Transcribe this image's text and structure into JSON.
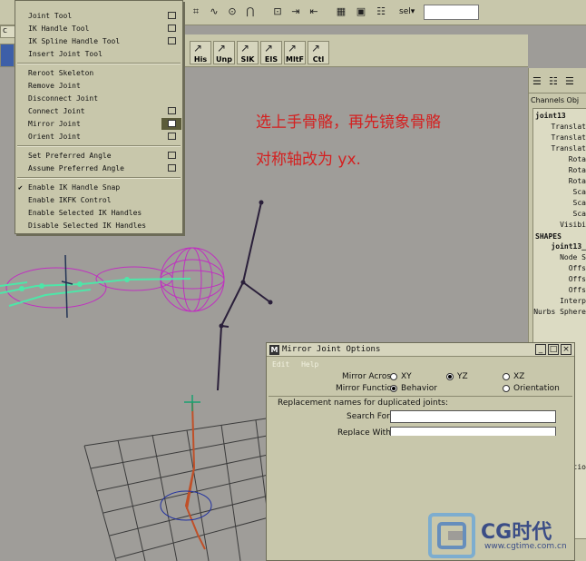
{
  "statusbar": {
    "icons": [
      "grid-snap-icon",
      "curve-snap-icon",
      "point-snap-icon",
      "magnet-icon",
      "history-icon",
      "input-icon",
      "output-icon",
      "render-icon",
      "ipr-render-icon",
      "render-settings-icon"
    ],
    "sel_label": "sel▾",
    "sel_value": ""
  },
  "shelf": {
    "tab_label": "c",
    "buttons": [
      {
        "label": "His"
      },
      {
        "label": "Unp"
      },
      {
        "label": "SIK"
      },
      {
        "label": "EIS"
      },
      {
        "label": "MltF"
      },
      {
        "label": "Ctl"
      }
    ]
  },
  "menu": {
    "items": [
      {
        "label": "Joint Tool",
        "has_option": true
      },
      {
        "label": "IK Handle Tool",
        "has_option": true
      },
      {
        "label": "IK Spline Handle Tool",
        "has_option": true
      },
      {
        "label": "Insert Joint Tool",
        "has_option": false
      },
      {
        "label": "Reroot Skeleton",
        "has_option": false
      },
      {
        "label": "Remove Joint",
        "has_option": false
      },
      {
        "label": "Disconnect Joint",
        "has_option": false
      },
      {
        "label": "Connect Joint",
        "has_option": true
      },
      {
        "label": "Mirror Joint",
        "has_option": true,
        "highlighted": true
      },
      {
        "label": "Orient Joint",
        "has_option": true
      },
      {
        "label": "Set Preferred Angle",
        "has_option": true
      },
      {
        "label": "Assume Preferred Angle",
        "has_option": true
      },
      {
        "label": "Enable IK Handle Snap",
        "checked": true
      },
      {
        "label": "Enable IKFK Control"
      },
      {
        "label": "Enable Selected IK Handles"
      },
      {
        "label": "Disable Selected IK Handles"
      }
    ]
  },
  "annotations": {
    "line1": "选上手骨骼，再先镜象骨骼",
    "line2": "对称轴改为 yx."
  },
  "channel_box": {
    "tabs": "Channels Obj",
    "object_name": "joint13",
    "attributes": [
      "Translat",
      "Translat",
      "Translat",
      "Rota",
      "Rota",
      "Rota",
      "Sca",
      "Sca",
      "Sca",
      "Visibi"
    ],
    "shapes_header": "SHAPES",
    "shape_name": "joint13_",
    "shape_attrs": [
      "Node S",
      "Offs",
      "Offs",
      "Offs",
      "Interp",
      "Nurbs Sphere"
    ],
    "lower_text": "tio"
  },
  "dialog": {
    "title": "Mirror Joint Options",
    "menus": [
      "Edit",
      "Help"
    ],
    "mirror_across_label": "Mirror Across",
    "mirror_across_options": [
      "XY",
      "YZ",
      "XZ"
    ],
    "mirror_across_selected": "YZ",
    "mirror_function_label": "Mirror Function",
    "mirror_function_options": [
      "Behavior",
      "Orientation"
    ],
    "mirror_function_selected": "Behavior",
    "replacement_header": "Replacement names for duplicated joints:",
    "search_for_label": "Search For:",
    "search_for_value": "",
    "replace_with_label": "Replace With:",
    "replace_with_value": ""
  },
  "watermark": {
    "brand": "CG时代",
    "url": "www.cgtime.com.cn"
  }
}
